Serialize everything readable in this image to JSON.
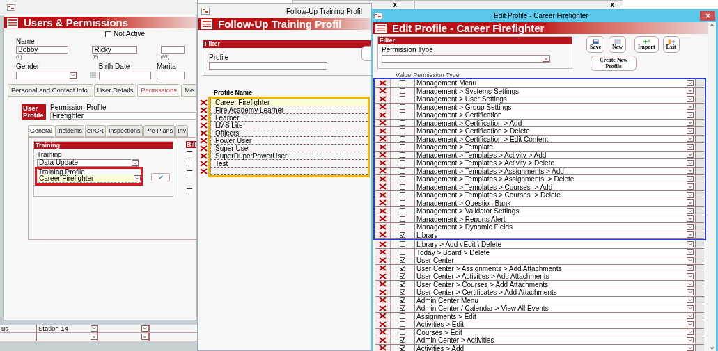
{
  "background_windows": [
    {
      "close": "x"
    },
    {
      "close": "x"
    }
  ],
  "users_window": {
    "header": "Users & Permissions",
    "not_active": {
      "label": "Not Active",
      "checked": false
    },
    "name_label": "Name",
    "name_fields": [
      {
        "value": "Bobby",
        "hint": "(L)"
      },
      {
        "value": "Ricky",
        "hint": "(F)"
      },
      {
        "hint": "(MI)"
      }
    ],
    "gender_label": "Gender",
    "birth_date_label": "Birth Date",
    "marital_label": "Marita",
    "tabs": [
      {
        "label": "Personal and Contact Info.",
        "selected": false
      },
      {
        "label": "User Details",
        "selected": false
      },
      {
        "label": "Permissions",
        "selected": true
      },
      {
        "label": "Me",
        "selected": false
      }
    ],
    "user_profile_badge": "User Profile",
    "permission_profile_label": "Permission Profile",
    "permission_profile_value": "Firefighter",
    "subtabs": [
      {
        "label": "General",
        "selected": true
      },
      {
        "label": "Incidents",
        "selected": false
      },
      {
        "label": "ePCR",
        "selected": false
      },
      {
        "label": "Inspections",
        "selected": false
      },
      {
        "label": "Pre-Plans",
        "selected": false
      },
      {
        "label": "Inv",
        "selected": false
      }
    ],
    "training_section": "Training",
    "training_label": "Training",
    "training_value": "Data Update",
    "training_profile_label": "Training Profile",
    "training_profile_value": "Career Firefighter",
    "training_profile_highlighted": true,
    "bill_section": "Bill",
    "bill_checks": [
      {
        "checked": false
      },
      {
        "checked": false
      },
      {
        "checked": false
      },
      {
        "checked": false
      }
    ],
    "grid_rows": [
      {
        "label": "us",
        "station": "Station 14"
      },
      {}
    ]
  },
  "training_profiles_window": {
    "title": "Follow-Up Training Profil",
    "header": "Follow-Up Training Profil",
    "filter_title": "Filter",
    "profile_label": "Profile",
    "column": "Profile Name",
    "highlighted": true,
    "profiles": [
      {
        "name": "Career Firefighter",
        "selected": true
      },
      {
        "name": "Fire Academy Learner",
        "selected": false
      },
      {
        "name": "Learner",
        "selected": false
      },
      {
        "name": "LMS Lite",
        "selected": false
      },
      {
        "name": "Officers",
        "selected": false
      },
      {
        "name": "Power User",
        "selected": false
      },
      {
        "name": "Super User",
        "selected": false
      },
      {
        "name": "SuperDuperPowerUser",
        "selected": false
      },
      {
        "name": "Test",
        "selected": false
      },
      {
        "selected": false
      }
    ]
  },
  "edit_profile_window": {
    "title": "Edit Profile - Career Firefighter",
    "header": "Edit Profile - Career Firefighter",
    "filter_title": "Filter",
    "permission_type_label": "Permission Type",
    "buttons": [
      {
        "label": "Save",
        "kind": "save"
      },
      {
        "label": "New",
        "kind": "new"
      },
      {
        "label": "Import",
        "kind": "import"
      },
      {
        "label": "Exit",
        "kind": "exit"
      }
    ],
    "create_button": "Create New Profile",
    "columns": [
      "Value",
      "Permission Type"
    ],
    "groups": [
      {
        "highlighted": true,
        "rows": [
          {
            "name": "Management Menu",
            "checked": false
          },
          {
            "name": "Management > Systems Settings",
            "checked": false
          },
          {
            "name": "Management > User Settings",
            "checked": false
          },
          {
            "name": "Management > Group Settings",
            "checked": false
          },
          {
            "name": "Management > Certification",
            "checked": false
          },
          {
            "name": "Management > Certification > Add",
            "checked": false
          },
          {
            "name": "Management > Certification > Delete",
            "checked": false
          },
          {
            "name": "Management > Certification > Edit Content",
            "checked": false
          },
          {
            "name": "Management > Template",
            "checked": false
          },
          {
            "name": "Management > Templates > Activity > Add",
            "checked": false
          },
          {
            "name": "Management > Templates > Activity > Delete",
            "checked": false
          },
          {
            "name": "Management > Templates > Assignments > Add",
            "checked": false
          },
          {
            "name": "Management > Templates > Assignments  > Delete",
            "checked": false
          },
          {
            "name": "Management > Templates > Courses  > Add",
            "checked": false
          },
          {
            "name": "Management > Templates > Courses  > Delete",
            "checked": false
          },
          {
            "name": "Management > Question Bank",
            "checked": false
          },
          {
            "name": "Management > Validator Settings",
            "checked": false
          },
          {
            "name": "Management > Reports Alert",
            "checked": false
          },
          {
            "name": "Management > Dynamic Fields",
            "checked": false
          },
          {
            "name": "Library",
            "checked": true
          }
        ]
      },
      {
        "highlighted": false,
        "rows": [
          {
            "name": "Library > Add \\ Edit \\ Delete",
            "checked": false
          },
          {
            "name": "Today > Board > Delete",
            "checked": false
          },
          {
            "name": "User Center",
            "checked": true
          },
          {
            "name": "User Center > Assignments > Add Attachments",
            "checked": true
          },
          {
            "name": "User Center > Activities > Add Attachments",
            "checked": true
          },
          {
            "name": "User Center > Courses > Add Attachments",
            "checked": true
          },
          {
            "name": "User Center > Certificates > Add Attachments",
            "checked": true
          },
          {
            "name": "Admin Center Menu",
            "checked": true
          },
          {
            "name": "Admin Center / Calendar > View All Events",
            "checked": true
          },
          {
            "name": "Assignments > Edit",
            "checked": false
          },
          {
            "name": "Activities > Edit",
            "checked": false
          },
          {
            "name": "Courses > Edit",
            "checked": false
          },
          {
            "name": "Admin Center > Activities",
            "checked": true
          },
          {
            "name": "Activities > Add",
            "checked": true
          }
        ]
      }
    ]
  }
}
